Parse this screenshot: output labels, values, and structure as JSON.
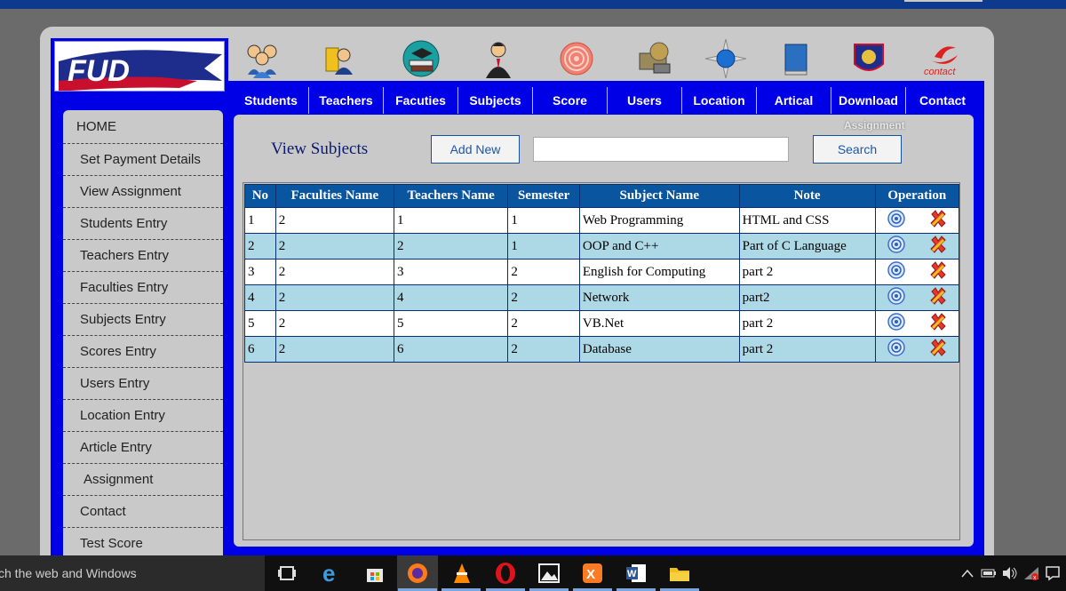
{
  "logo": {
    "text": "FUD"
  },
  "header_icons": [
    {
      "name": "students-icon"
    },
    {
      "name": "teachers-icon"
    },
    {
      "name": "faculties-icon"
    },
    {
      "name": "subjects-icon"
    },
    {
      "name": "score-icon"
    },
    {
      "name": "users-icon"
    },
    {
      "name": "location-icon"
    },
    {
      "name": "article-icon"
    },
    {
      "name": "download-icon"
    },
    {
      "name": "contact-icon",
      "label": "contact"
    }
  ],
  "nav": {
    "items": [
      "Students",
      "Teachers",
      "Facuties",
      "Subjects",
      "Score",
      "Users",
      "Location",
      "Artical",
      "Download",
      "Contact"
    ],
    "sub_label": "Assignment"
  },
  "sidebar": {
    "items": [
      "HOME",
      "Set Payment Details",
      "View Assignment",
      "Students Entry",
      "Teachers Entry",
      "Faculties Entry",
      "Subjects Entry",
      "Scores Entry",
      "Users Entry",
      "Location Entry",
      "Article Entry",
      "Assignment",
      "Contact",
      "Test Score"
    ]
  },
  "content": {
    "title": "View Subjects",
    "add_new_label": "Add New",
    "search_value": "",
    "search_label": "Search"
  },
  "table": {
    "headers": [
      "No",
      "Faculties Name",
      "Teachers Name",
      "Semester",
      "Subject Name",
      "Note",
      "Operation"
    ],
    "rows": [
      [
        "1",
        "2",
        "1",
        "1",
        "Web Programming",
        "HTML and CSS"
      ],
      [
        "2",
        "2",
        "2",
        "1",
        "OOP and C++",
        "Part of C Language"
      ],
      [
        "3",
        "2",
        "3",
        "2",
        "English for Computing",
        "part 2"
      ],
      [
        "4",
        "2",
        "4",
        "2",
        "Network",
        "part2"
      ],
      [
        "5",
        "2",
        "5",
        "2",
        "VB.Net",
        "part 2"
      ],
      [
        "6",
        "2",
        "6",
        "2",
        "Database",
        "part 2"
      ]
    ]
  },
  "taskbar": {
    "search_text": "ch the web and Windows"
  },
  "colors": {
    "frame_blue": "#0000e6",
    "table_header": "#0a55a0",
    "row_alt": "#add8e6",
    "panel_gray": "#c9c9c9"
  }
}
